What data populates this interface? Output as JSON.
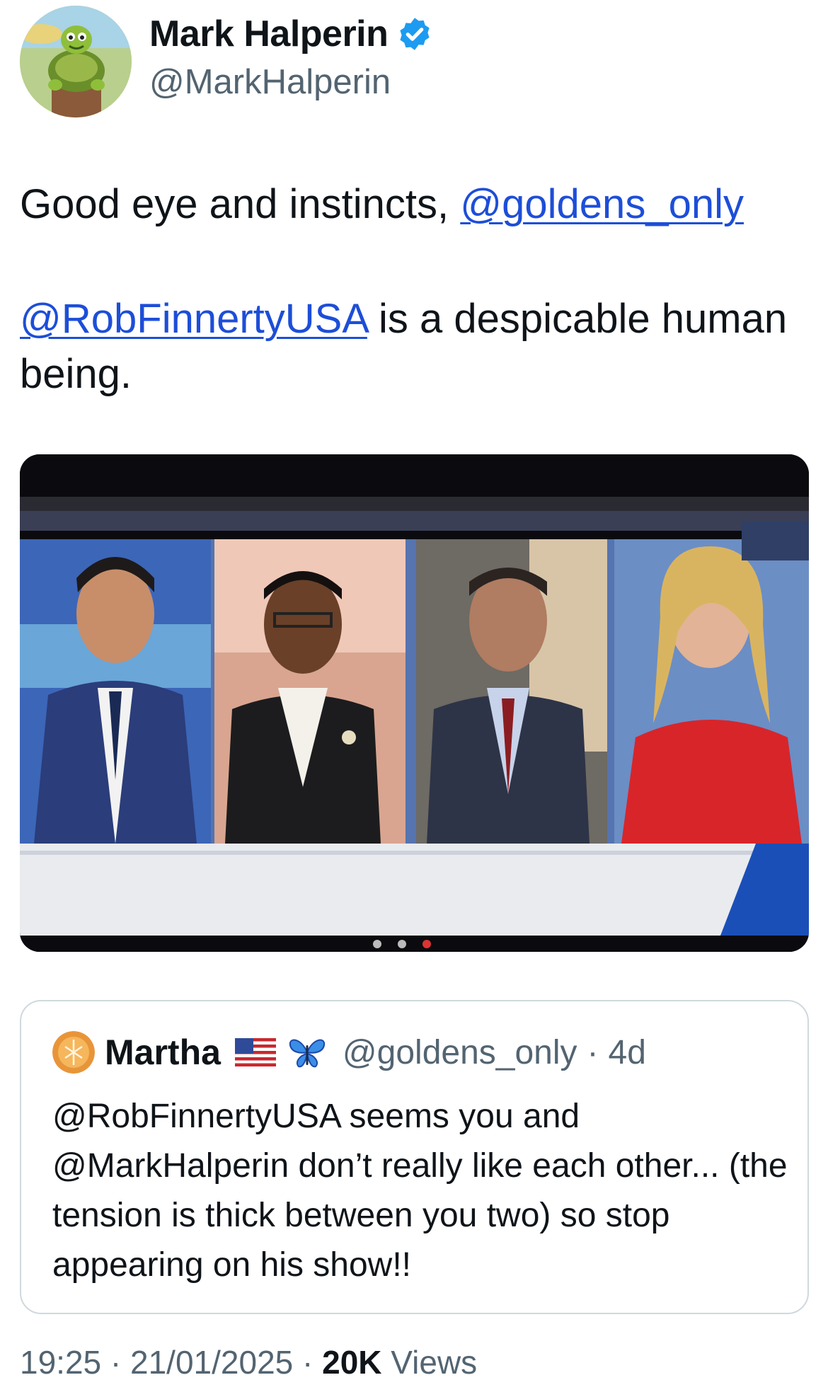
{
  "author": {
    "name": "Mark Halperin",
    "handle": "@MarkHalperin",
    "avatar_icon": "turtle-avatar",
    "verified_icon": "verified-badge-icon",
    "verified_color": "#1d9bf0"
  },
  "tweet": {
    "line1_prefix": "Good eye and instincts, ",
    "line1_mention": "@goldens_only",
    "line2_mention": "@RobFinnertyUSA",
    "line2_suffix": " is a despicable human being."
  },
  "media": {
    "description_icon": "tv-panel-image"
  },
  "quote": {
    "name": "Martha",
    "flag_icon": "us-flag-icon",
    "butterfly_icon": "butterfly-icon",
    "handle": "@goldens_only",
    "separator": " · ",
    "time": "4d",
    "text": "@RobFinnertyUSA seems you and @MarkHalperin don’t really like each other... (the tension is thick between you two) so stop appearing on his show!!"
  },
  "meta": {
    "time": "19:25",
    "sep1": " · ",
    "date": "21/01/2025",
    "sep2": " · ",
    "views_count": "20K",
    "views_label": " Views"
  },
  "colors": {
    "link": "#1d4ed8",
    "secondary_text": "#536471",
    "border": "#cfd9de"
  }
}
